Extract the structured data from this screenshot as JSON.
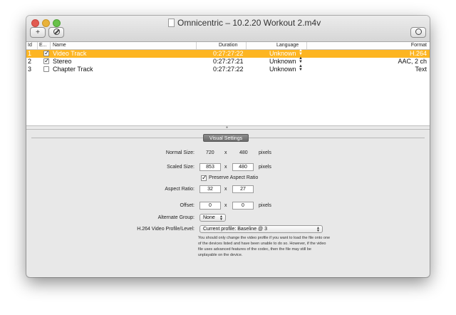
{
  "window": {
    "title": "Omnicentric – 10.2.20 Workout 2.m4v"
  },
  "toolbar": {
    "add_label": "+",
    "remove_icon": "no-entry-icon",
    "settings_icon": "target-icon"
  },
  "table": {
    "headers": {
      "id": "Id",
      "enabled": "E...",
      "name": "Name",
      "duration": "Duration",
      "language": "Language",
      "format": "Format"
    },
    "rows": [
      {
        "id": "1",
        "enabled": true,
        "name": "Video Track",
        "duration": "0:27:27:22",
        "language": "Unknown",
        "format": "H.264",
        "selected": true
      },
      {
        "id": "2",
        "enabled": true,
        "name": "Stereo",
        "duration": "0:27:27:21",
        "language": "Unknown",
        "format": "AAC, 2 ch",
        "selected": false
      },
      {
        "id": "3",
        "enabled": false,
        "name": "Chapter Track",
        "duration": "0:27:27:22",
        "language": "Unknown",
        "format": "Text",
        "selected": false
      }
    ]
  },
  "settings": {
    "tab": "Visual Settings",
    "normal_size": {
      "label": "Normal Size:",
      "width": "720",
      "x": "x",
      "height": "480",
      "unit": "pixels"
    },
    "scaled_size": {
      "label": "Scaled Size:",
      "width": "853",
      "x": "x",
      "height": "480",
      "unit": "pixels"
    },
    "preserve_aspect": {
      "label": "Preserve Aspect Ratio",
      "checked": true
    },
    "aspect_ratio": {
      "label": "Aspect Ratio:",
      "w": "32",
      "x": "x",
      "h": "27"
    },
    "offset": {
      "label": "Offset:",
      "x_val": "0",
      "x": "x",
      "y_val": "0",
      "unit": "pixels"
    },
    "alternate_group": {
      "label": "Alternate Group:",
      "value": "None"
    },
    "profile": {
      "label": "H.264 Video Profile/Level:",
      "value": "Current profile: Baseline @ 3"
    },
    "note": "You should only change the video profile if you want to load the file onto one of the devices listed and have been unable to do so.  However, if the video file uses advanced features of the codec, then the file may still be unplayable on the device."
  },
  "colors": {
    "selection": "#fdb521",
    "window_bg": "#e8e8e8"
  }
}
